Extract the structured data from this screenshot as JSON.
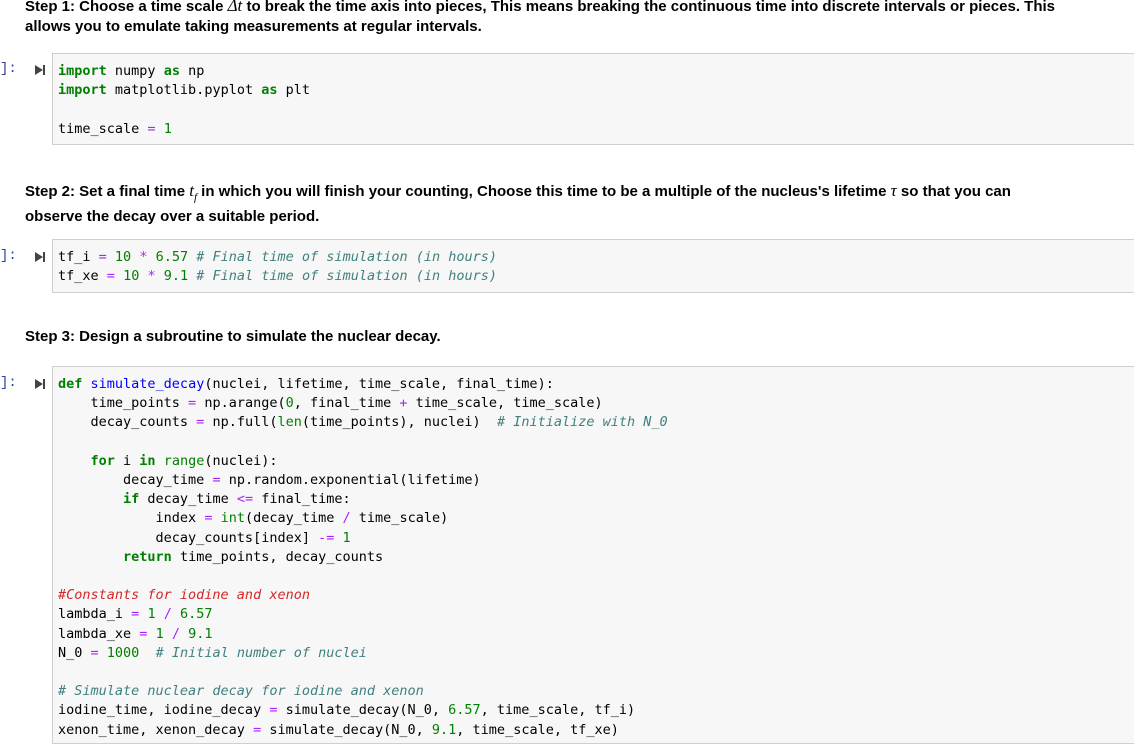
{
  "step1": {
    "line1_a": "Step 1: Choose a time scale ",
    "delta_t": "Δt",
    "line1_b": " to break the time axis into pieces, This means breaking the continuous time into discrete intervals or pieces. This",
    "line2": "allows you to emulate taking measurements at regular intervals."
  },
  "step2": {
    "line1_a": "Step 2: Set a final time ",
    "tf": "t",
    "tf_sub": "f",
    "line1_b": " in which you will finish your counting, Choose this time to be a multiple of the nucleus's lifetime ",
    "tau": "τ",
    "line1_c": " so that you can",
    "line2": "observe the decay over a suitable period."
  },
  "step3": {
    "text": "Step 3: Design a subroutine to simulate the nuclear decay."
  },
  "prompts": [
    "]:",
    "]:",
    "]:"
  ],
  "run_icon": "run-cell-icon",
  "colors": {
    "keyword": "#008000",
    "operator": "#aa22ff",
    "function_name": "#0000ff",
    "comment": "#408080",
    "comment_highlight": "#d62728",
    "cell_bg": "#f7f7f7"
  },
  "cells": [
    {
      "code": "import numpy as np\nimport matplotlib.pyplot as plt\n\ntime_scale = 1"
    },
    {
      "code": "tf_i = 10 * 6.57 # Final time of simulation (in hours)\ntf_xe = 10 * 9.1 # Final time of simulation (in hours)"
    },
    {
      "code": "def simulate_decay(nuclei, lifetime, time_scale, final_time):\n    time_points = np.arange(0, final_time + time_scale, time_scale)\n    decay_counts = np.full(len(time_points), nuclei)  # Initialize with N_0\n\n    for i in range(nuclei):\n        decay_time = np.random.exponential(lifetime)\n        if decay_time <= final_time:\n            index = int(decay_time / time_scale)\n            decay_counts[index] -= 1\n        return time_points, decay_counts\n\n#Constants for iodine and xenon\nlambda_i = 1 / 6.57\nlambda_xe = 1 / 9.1\nN_0 = 1000  # Initial number of nuclei\n\n# Simulate nuclear decay for iodine and xenon\niodine_time, iodine_decay = simulate_decay(N_0, 6.57, time_scale, tf_i)\nxenon_time, xenon_decay = simulate_decay(N_0, 9.1, time_scale, tf_xe)"
    }
  ]
}
